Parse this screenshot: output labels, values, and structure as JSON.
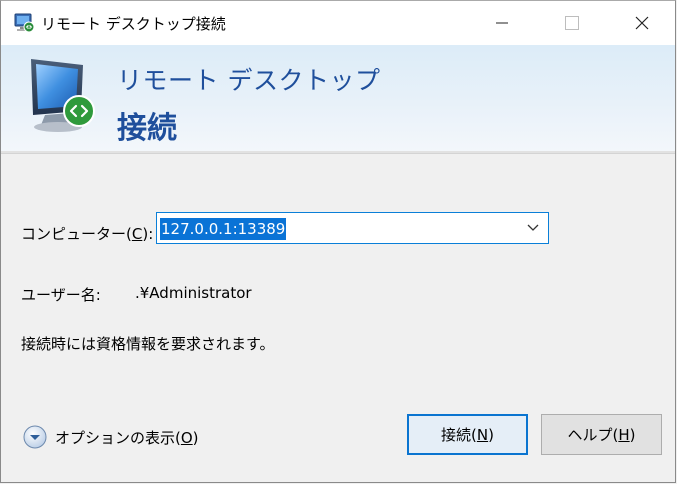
{
  "window": {
    "title": "リモート デスクトップ接続"
  },
  "banner": {
    "line1": "リモート デスクトップ",
    "line2": "接続"
  },
  "form": {
    "computer_label": "コンピューター(",
    "computer_mnemonic": "C",
    "computer_label_end": "):",
    "computer_value": "127.0.0.1:13389",
    "user_label": "ユーザー名:",
    "user_value": ".¥Administrator",
    "info_text": "接続時には資格情報を要求されます。"
  },
  "footer": {
    "options_label": "オプションの表示(",
    "options_mnemonic": "O",
    "options_label_end": ")",
    "connect_label": "接続(",
    "connect_mnemonic": "N",
    "connect_label_end": ")",
    "help_label": "ヘルプ(",
    "help_mnemonic": "H",
    "help_label_end": ")"
  },
  "colors": {
    "accent": "#0a73d6",
    "banner_text": "#1f4f9c"
  },
  "icons": {
    "app": "remote-desktop-icon",
    "minimize": "minimize-icon",
    "maximize": "maximize-icon",
    "close": "close-icon",
    "dropdown": "chevron-down-icon",
    "options": "expand-circle-icon"
  }
}
